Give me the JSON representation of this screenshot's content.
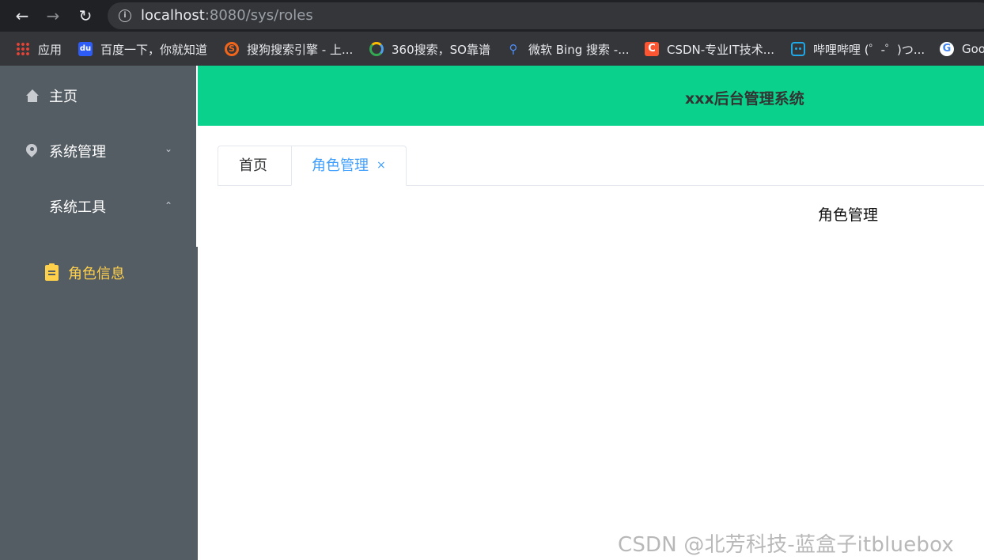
{
  "browser": {
    "url_host": "localhost",
    "url_path": ":8080/sys/roles",
    "bookmarks": [
      {
        "label": "应用",
        "icon": "apps-grid-icon"
      },
      {
        "label": "百度一下，你就知道",
        "icon": "baidu-icon"
      },
      {
        "label": "搜狗搜索引擎 - 上...",
        "icon": "sogou-icon"
      },
      {
        "label": "360搜索，SO靠谱",
        "icon": "360-search-icon"
      },
      {
        "label": "微软 Bing 搜索 -...",
        "icon": "bing-search-icon"
      },
      {
        "label": "CSDN-专业IT技术...",
        "icon": "csdn-icon"
      },
      {
        "label": "哔哩哔哩 (゜-゜)つ...",
        "icon": "bilibili-icon"
      },
      {
        "label": "Goo",
        "icon": "google-icon"
      }
    ]
  },
  "sidebar": {
    "items": [
      {
        "label": "主页",
        "icon": "house-icon"
      },
      {
        "label": "系统管理",
        "icon": "pin-icon",
        "chevron": "chevron-down-icon"
      },
      {
        "label": "系统工具",
        "chevron": "chevron-up-icon"
      }
    ],
    "submenu": {
      "label": "角色信息",
      "icon": "clipboard-icon",
      "active_color": "#ffd04b"
    },
    "background": "#545c64"
  },
  "header": {
    "title": "xxx后台管理系统",
    "background": "#0ad28c"
  },
  "tabs": [
    {
      "label": "首页"
    },
    {
      "label": "角色管理",
      "closable": true,
      "close_glyph": "×",
      "active": true,
      "active_color": "#409eff"
    }
  ],
  "content": {
    "text": "角色管理"
  },
  "watermark": "CSDN @北芳科技-蓝盒子itbluebox"
}
